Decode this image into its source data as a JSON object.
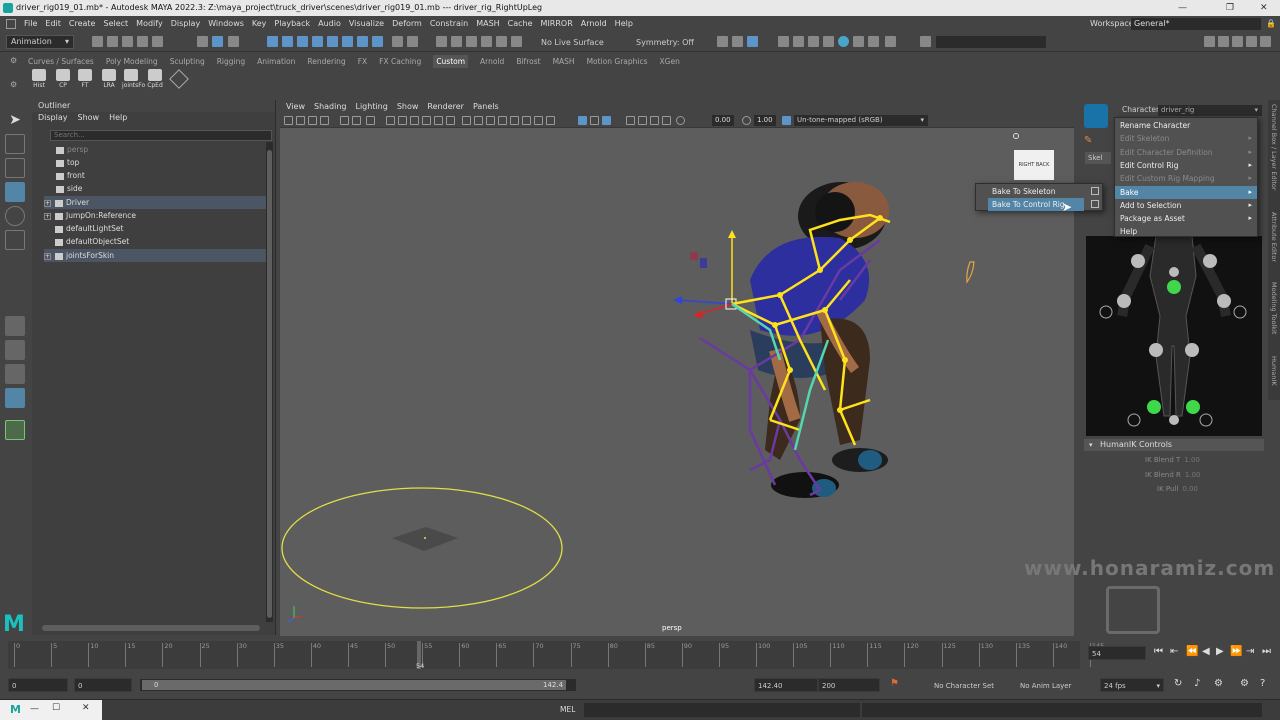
{
  "title_bar": {
    "text": "driver_rig019_01.mb* - Autodesk MAYA 2022.3: Z:\\maya_project\\truck_driver\\scenes\\driver_rig019_01.mb   ---   driver_rig_RightUpLeg"
  },
  "menu": [
    "File",
    "Edit",
    "Create",
    "Select",
    "Modify",
    "Display",
    "Windows",
    "Key",
    "Playback",
    "Audio",
    "Visualize",
    "Deform",
    "Constrain",
    "MASH",
    "Cache",
    "MIRROR",
    "Arnold",
    "Help"
  ],
  "workspace": {
    "label": "Workspace:",
    "value": "General*"
  },
  "toolbar": {
    "mode": "Animation",
    "live_surface": "No Live Surface",
    "symmetry": "Symmetry: Off"
  },
  "shelf_tabs": [
    "Curves / Surfaces",
    "Poly Modeling",
    "Sculpting",
    "Rigging",
    "Animation",
    "Rendering",
    "FX",
    "FX Caching",
    "Custom",
    "Arnold",
    "Bifrost",
    "MASH",
    "Motion Graphics",
    "XGen"
  ],
  "shelf_active": "Custom",
  "shelf_icons": [
    "Hist",
    "CP",
    "FT",
    "LRA",
    "jointsFo",
    "CpEd"
  ],
  "outliner": {
    "title": "Outliner",
    "menu": [
      "Display",
      "Show",
      "Help"
    ],
    "search_placeholder": "Search...",
    "items": [
      {
        "label": "persp",
        "dim": true
      },
      {
        "label": "top"
      },
      {
        "label": "front"
      },
      {
        "label": "side"
      },
      {
        "label": "Driver"
      },
      {
        "label": "JumpOn:Reference"
      },
      {
        "label": "defaultLightSet"
      },
      {
        "label": "defaultObjectSet"
      },
      {
        "label": "jointsForSkin"
      }
    ]
  },
  "viewport": {
    "menu": [
      "View",
      "Shading",
      "Lighting",
      "Show",
      "Renderer",
      "Panels"
    ],
    "exposure": "0.00",
    "gamma": "1.00",
    "color_space": "Un-tone-mapped (sRGB)",
    "camera_label": "persp",
    "viewcube": [
      "RIGHT",
      "BACK"
    ]
  },
  "humanik": {
    "character_label": "Character:",
    "character_value": "driver_rig",
    "tab": "Skel",
    "controls_title": "HumanIK Controls",
    "ik_rows": [
      {
        "label": "IK Blend T",
        "value": "1.00"
      },
      {
        "label": "IK Blend R",
        "value": "1.00"
      },
      {
        "label": "IK Pull",
        "value": "0.00"
      }
    ]
  },
  "side_tabs": [
    "Channel Box / Layer Editor",
    "Attribute Editor",
    "Modeling Toolkit",
    "HumanIK"
  ],
  "context_menu": [
    {
      "label": "Rename Character",
      "state": "normal"
    },
    {
      "label": "Edit Skeleton",
      "state": "disabled",
      "submenu": true
    },
    {
      "label": "Edit Character Definition",
      "state": "disabled",
      "submenu": true
    },
    {
      "label": "Edit Control Rig",
      "state": "normal",
      "submenu": true
    },
    {
      "label": "Edit Custom Rig Mapping",
      "state": "disabled",
      "submenu": true
    },
    {
      "label": "Bake",
      "state": "highlight",
      "submenu": true
    },
    {
      "label": "Add to Selection",
      "state": "normal",
      "submenu": true
    },
    {
      "label": "Package as Asset",
      "state": "normal",
      "submenu": true
    },
    {
      "label": "Help",
      "state": "normal"
    }
  ],
  "bake_submenu": [
    {
      "label": "Bake To Skeleton",
      "highlight": false
    },
    {
      "label": "Bake To Control Rig",
      "highlight": true
    }
  ],
  "timeline": {
    "ticks": [
      "0",
      "5",
      "10",
      "15",
      "20",
      "25",
      "30",
      "35",
      "40",
      "45",
      "50",
      "55",
      "60",
      "65",
      "70",
      "75",
      "80",
      "85",
      "90",
      "95",
      "100",
      "105",
      "110",
      "115",
      "120",
      "125",
      "130",
      "135",
      "140",
      "145"
    ],
    "current": "54",
    "current_field": "54"
  },
  "range": {
    "start": "0",
    "anim_start": "0",
    "range_start": "0",
    "range_end": "142.4",
    "anim_end": "142.40",
    "end": "200",
    "character_set": "No Character Set",
    "anim_layer": "No Anim Layer",
    "fps": "24 fps"
  },
  "status": {
    "mel": "MEL"
  },
  "watermark": "www.honaramiz.com",
  "colors": {
    "accent": "#5285a6",
    "joint_yellow": "#ffe21a",
    "ik_green": "#3fd84a"
  }
}
